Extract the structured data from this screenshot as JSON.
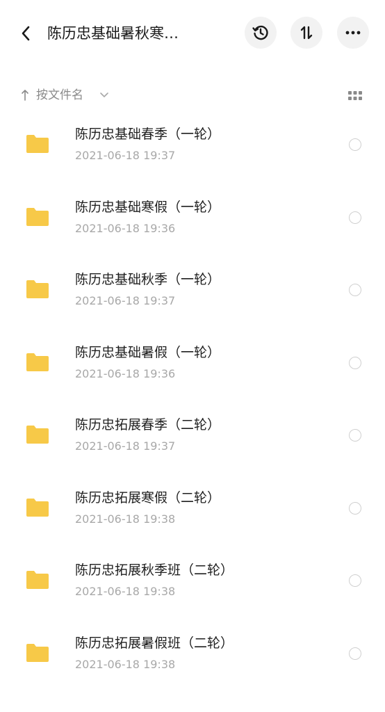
{
  "header": {
    "title": "陈历忠基础暑秋寒…",
    "back_icon": "chevron-left-icon",
    "actions": [
      "history-icon",
      "sort-icon",
      "more-icon"
    ]
  },
  "sortbar": {
    "label": "按文件名",
    "arrow_icon": "arrow-up-icon",
    "chevron_icon": "chevron-down-icon",
    "view_icon": "grid-view-icon"
  },
  "colors": {
    "folder": "#f7c948",
    "text_primary": "#1f1f1f",
    "text_secondary": "#a8a8a8",
    "button_bg": "#f2f2f2"
  },
  "files": [
    {
      "name": "陈历忠基础春季（一轮）",
      "date": "2021-06-18  19:37"
    },
    {
      "name": "陈历忠基础寒假（一轮）",
      "date": "2021-06-18  19:36"
    },
    {
      "name": "陈历忠基础秋季（一轮）",
      "date": "2021-06-18  19:37"
    },
    {
      "name": "陈历忠基础暑假（一轮）",
      "date": "2021-06-18  19:36"
    },
    {
      "name": "陈历忠拓展春季（二轮）",
      "date": "2021-06-18  19:37"
    },
    {
      "name": "陈历忠拓展寒假（二轮）",
      "date": "2021-06-18  19:38"
    },
    {
      "name": "陈历忠拓展秋季班（二轮）",
      "date": "2021-06-18  19:38"
    },
    {
      "name": "陈历忠拓展暑假班（二轮）",
      "date": "2021-06-18  19:38"
    }
  ]
}
